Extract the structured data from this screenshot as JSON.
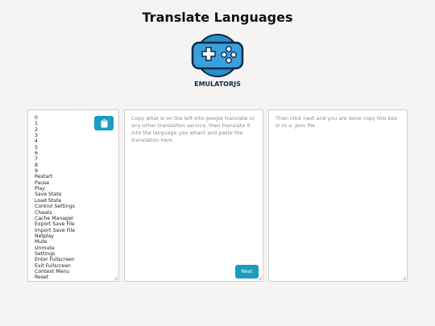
{
  "page": {
    "title": "Translate Languages"
  },
  "logo": {
    "text": "EMULATORJS",
    "icon": "gamepad-icon",
    "color": "#2a8fd0"
  },
  "keys_panel": {
    "copy_icon": "clipboard-icon",
    "keys": [
      "0",
      "1",
      "2",
      "3",
      "4",
      "5",
      "6",
      "7",
      "8",
      "9",
      "Restart",
      "Pause",
      "Play",
      "Save State",
      "Load State",
      "Control Settings",
      "Cheats",
      "Cache Manager",
      "Export Save File",
      "Import Save File",
      "Netplay",
      "Mute",
      "Unmute",
      "Settings",
      "Enter Fullscreen",
      "Exit Fullscreen",
      "Context Menu",
      "Reset"
    ]
  },
  "translate_panel": {
    "placeholder": "Copy what is on the left into google translate or any other translation service, then translate it into the language you whant and paste the translation here.",
    "next_label": "Next"
  },
  "output_panel": {
    "placeholder": "Then click next and you are done copy this box in to a .json file"
  },
  "colors": {
    "accent": "#1a9dc0",
    "background": "#f5f4f2"
  }
}
